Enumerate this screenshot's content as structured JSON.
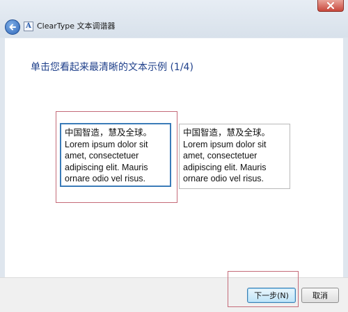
{
  "window": {
    "title": "ClearType 文本调谐器",
    "app_icon_glyph": "A"
  },
  "instruction": "单击您看起来最清晰的文本示例 (1/4)",
  "samples": [
    {
      "lines": [
        "中国智造，慧及全球。",
        "Lorem ipsum dolor sit",
        "amet, consectetuer",
        "adipiscing elit. Mauris",
        "ornare odio vel risus."
      ],
      "selected": true
    },
    {
      "lines": [
        "中国智造，慧及全球。",
        "Lorem ipsum dolor sit",
        "amet, consectetuer",
        "adipiscing elit. Mauris",
        "ornare odio vel risus."
      ],
      "selected": false
    }
  ],
  "buttons": {
    "next": "下一步(N)",
    "cancel": "取消"
  },
  "colors": {
    "instruction": "#1e3f8a",
    "selection_border": "#3a7bb8",
    "highlight_frame": "#c46a78"
  }
}
